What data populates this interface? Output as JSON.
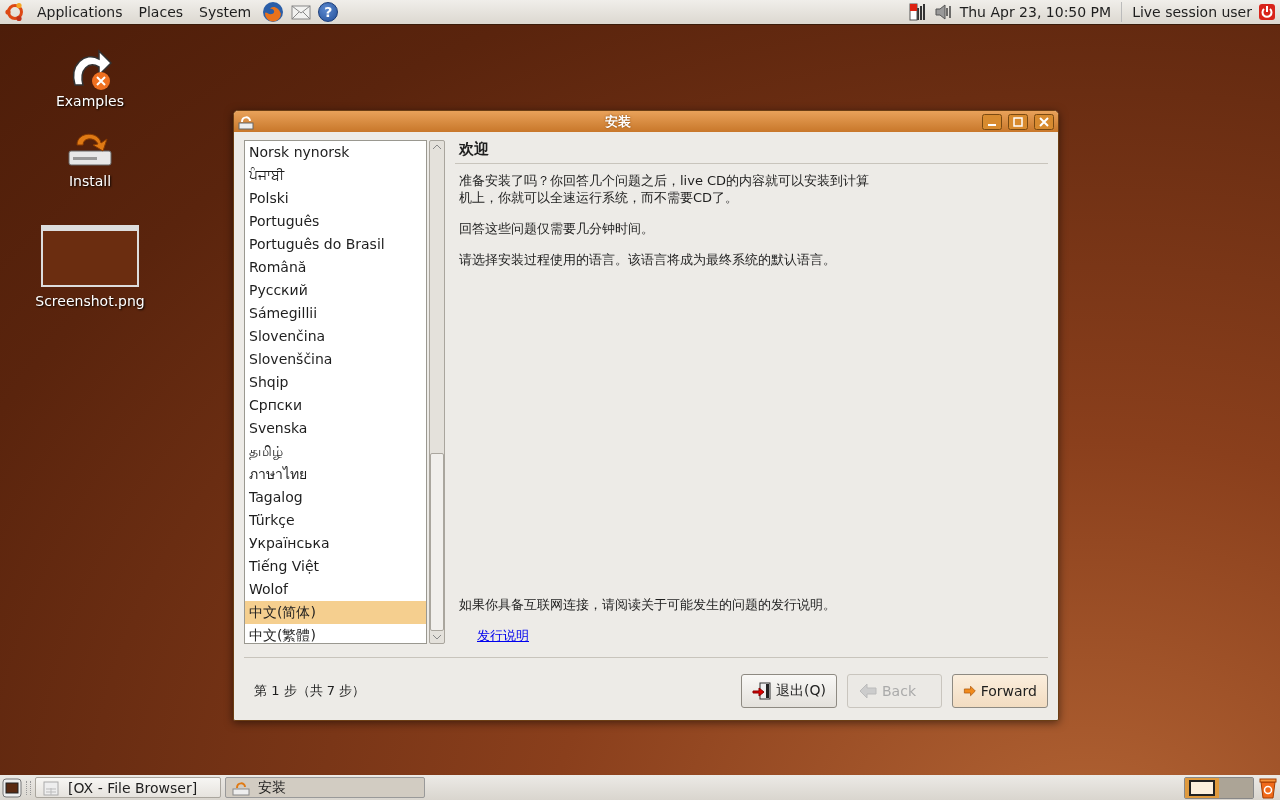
{
  "top_panel": {
    "menus": [
      "Applications",
      "Places",
      "System"
    ],
    "help_glyph": "?",
    "clock": "Thu Apr 23, 10:50 PM",
    "user": "Live session user"
  },
  "desktop_icons": [
    {
      "label": "Examples",
      "kind": "folder-link"
    },
    {
      "label": "Install",
      "kind": "installer"
    },
    {
      "label": "Screenshot.png",
      "kind": "image"
    }
  ],
  "window": {
    "title": "安装",
    "languages": [
      {
        "label": "Norsk nynorsk",
        "selected": false
      },
      {
        "label": "ਪੰਜਾਬੀ",
        "selected": false
      },
      {
        "label": "Polski",
        "selected": false
      },
      {
        "label": "Português",
        "selected": false
      },
      {
        "label": "Português do Brasil",
        "selected": false
      },
      {
        "label": "Română",
        "selected": false
      },
      {
        "label": "Русский",
        "selected": false
      },
      {
        "label": "Sámegillii",
        "selected": false
      },
      {
        "label": "Slovenčina",
        "selected": false
      },
      {
        "label": "Slovenščina",
        "selected": false
      },
      {
        "label": "Shqip",
        "selected": false
      },
      {
        "label": "Српски",
        "selected": false
      },
      {
        "label": "Svenska",
        "selected": false
      },
      {
        "label": "தமிழ்",
        "selected": false
      },
      {
        "label": "ภาษาไทย",
        "selected": false
      },
      {
        "label": "Tagalog",
        "selected": false
      },
      {
        "label": "Türkçe",
        "selected": false
      },
      {
        "label": "Українська",
        "selected": false
      },
      {
        "label": "Tiếng Việt",
        "selected": false
      },
      {
        "label": "Wolof",
        "selected": false
      },
      {
        "label": "中文(简体)",
        "selected": true
      },
      {
        "label": "中文(繁體)",
        "selected": false
      }
    ],
    "heading": "欢迎",
    "paragraphs": [
      "准备安装了吗？你回答几个问题之后，live CD的内容就可以安装到计算机上，你就可以全速运行系统，而不需要CD了。",
      "回答这些问题仅需要几分钟时间。",
      "请选择安装过程使用的语言。该语言将成为最终系统的默认语言。"
    ],
    "release_note": "如果你具备互联网连接，请阅读关于可能发生的问题的发行说明。",
    "release_link": "发行说明",
    "step": "第 1 步（共 7 步）",
    "buttons": [
      {
        "label": "退出(Q)",
        "kind": "quit",
        "disabled": false
      },
      {
        "label": "Back",
        "kind": "back",
        "disabled": true
      },
      {
        "label": "Forward",
        "kind": "forward",
        "disabled": false
      }
    ]
  },
  "taskbar": {
    "tasks": [
      {
        "label": "[OX - File Browser]",
        "kind": "file-browser",
        "selected": false
      },
      {
        "label": "安装",
        "kind": "installer",
        "selected": true
      }
    ],
    "workspaces": [
      {
        "selected": true
      },
      {
        "selected": false
      }
    ]
  }
}
